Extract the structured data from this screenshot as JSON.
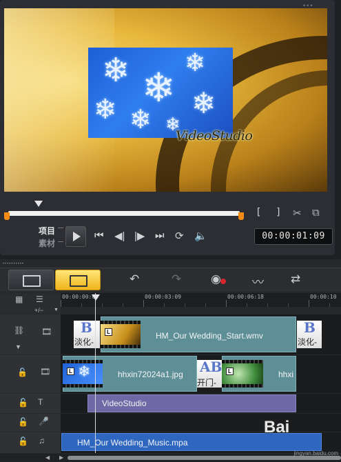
{
  "preview": {
    "watermark_text": "VideoStudio",
    "mode_project": "项目",
    "mode_clip": "素材",
    "timecode": "00:00:01:09",
    "bracket_in": "[",
    "bracket_out": "]",
    "icons": {
      "cut": "scissors-icon",
      "copy": "copy-icon",
      "home": "skip-to-start-icon",
      "prev": "previous-frame-icon",
      "next": "next-frame-icon",
      "end": "skip-to-end-icon",
      "repeat": "repeat-icon",
      "volume": "volume-icon"
    }
  },
  "toolbar": {
    "icons": [
      "undo-icon",
      "redo-icon",
      "record-capture-icon",
      "audio-mixer-icon",
      "auto-music-icon"
    ],
    "add_remove": "+/−",
    "accent": "#f0b31a"
  },
  "ruler": {
    "labels": [
      "00:00:00:00",
      "00:00:03:09",
      "00:00:06:18",
      "00:00:10"
    ]
  },
  "tracks": {
    "video": {
      "transition_label": "淡化-",
      "main_clip_label": "HM_Our Wedding_Start.wmv",
      "end_transition_label": "淡化-"
    },
    "overlay": {
      "clip1_label": "hhxin72024a1.jpg",
      "transition_label": "开门-派",
      "clip2_label": "hhxi"
    },
    "title": {
      "clip_label": "VideoStudio"
    },
    "music": {
      "clip_label": "HM_Our Wedding_Music.mpa"
    }
  },
  "watermark_logo": "Bai",
  "watermark_site": "jingyan.baidu.com"
}
